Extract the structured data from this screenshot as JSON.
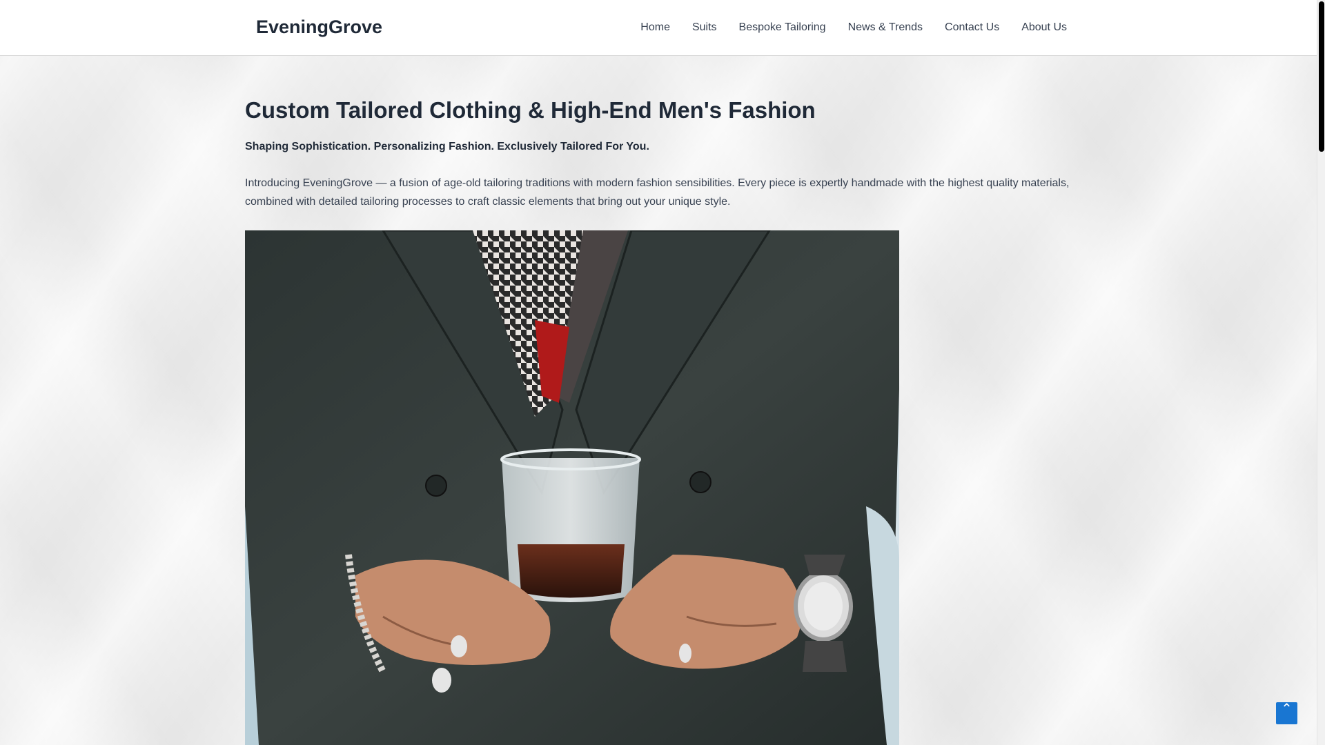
{
  "header": {
    "brand": "EveningGrove",
    "nav": [
      {
        "label": "Home"
      },
      {
        "label": "Suits"
      },
      {
        "label": "Bespoke Tailoring"
      },
      {
        "label": "News & Trends"
      },
      {
        "label": "Contact Us"
      },
      {
        "label": "About Us"
      }
    ]
  },
  "main": {
    "title": "Custom Tailored Clothing & High-End Men's Fashion",
    "tagline": "Shaping Sophistication. Personalizing Fashion. Exclusively Tailored For You.",
    "intro": "Introducing EveningGrove — a fusion of age-old tailoring traditions with modern fashion sensibilities. Every piece is expertly handmade with the highest quality materials, combined with detailed tailoring processes to craft classic elements that bring out your unique style."
  },
  "icons": {
    "back_to_top": "chevron-up-icon"
  },
  "colors": {
    "accent": "#1976d2",
    "text": "#1f2937"
  }
}
